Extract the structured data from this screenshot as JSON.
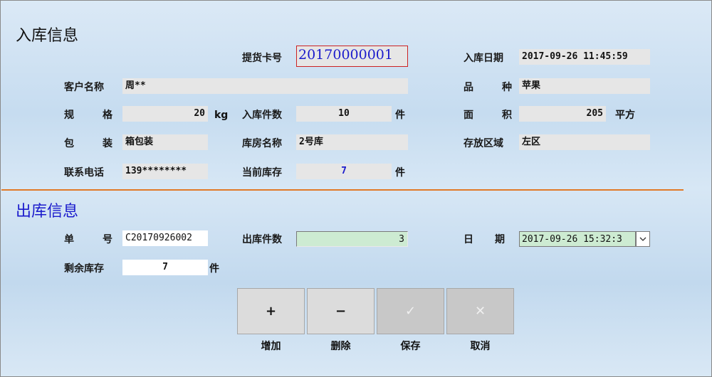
{
  "inbound": {
    "title": "入库信息",
    "card_no": {
      "label": "提货卡号",
      "value": "20170000001"
    },
    "date": {
      "label": "入库日期",
      "value": "2017-09-26 11:45:59"
    },
    "customer": {
      "label": "客户名称",
      "value": "周**"
    },
    "variety": {
      "label": "品种",
      "label_a": "品",
      "label_b": "种",
      "value": "苹果"
    },
    "spec": {
      "label_a": "规",
      "label_b": "格",
      "value": "20",
      "unit": "kg"
    },
    "in_qty": {
      "label": "入库件数",
      "value": "10",
      "unit": "件"
    },
    "area": {
      "label_a": "面",
      "label_b": "积",
      "value": "205",
      "unit": "平方"
    },
    "packaging": {
      "label_a": "包",
      "label_b": "装",
      "value": "箱包装"
    },
    "warehouse": {
      "label": "库房名称",
      "value": "2号库"
    },
    "zone": {
      "label": "存放区域",
      "value": "左区"
    },
    "phone": {
      "label": "联系电话",
      "value": "139********"
    },
    "current_stock": {
      "label": "当前库存",
      "value": "7",
      "unit": "件"
    }
  },
  "outbound": {
    "title": "出库信息",
    "order_no": {
      "label_a": "单",
      "label_b": "号",
      "value": "C20170926002"
    },
    "out_qty": {
      "label": "出库件数",
      "value": "3"
    },
    "date": {
      "label_a": "日",
      "label_b": "期",
      "value": "2017-09-26 15:32:3"
    },
    "remaining": {
      "label": "剩余库存",
      "value": "7",
      "unit": "件"
    }
  },
  "buttons": {
    "add": {
      "icon": "+",
      "label": "增加"
    },
    "delete": {
      "icon": "−",
      "label": "删除"
    },
    "save": {
      "icon": "✓",
      "label": "保存"
    },
    "cancel": {
      "icon": "✕",
      "label": "取消"
    }
  },
  "colors": {
    "accent_blue": "#1a1acc",
    "divider_orange": "#e07a28",
    "highlight_green": "#cdebd2",
    "card_border": "#cc2222"
  }
}
